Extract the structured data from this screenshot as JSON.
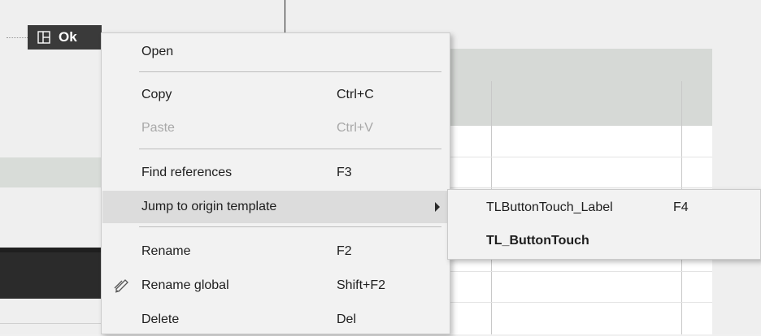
{
  "canvas": {
    "button_label": "Ok"
  },
  "context_menu": {
    "open": "Open",
    "copy": "Copy",
    "copy_shortcut": "Ctrl+C",
    "paste": "Paste",
    "paste_shortcut": "Ctrl+V",
    "find_references": "Find references",
    "find_references_shortcut": "F3",
    "jump_to_origin": "Jump to origin template",
    "rename": "Rename",
    "rename_shortcut": "F2",
    "rename_global": "Rename global",
    "rename_global_shortcut": "Shift+F2",
    "delete": "Delete",
    "delete_shortcut": "Del"
  },
  "submenu": {
    "item1": "TLButtonTouch_Label",
    "item1_shortcut": "F4",
    "item2": "TL_ButtonTouch"
  }
}
